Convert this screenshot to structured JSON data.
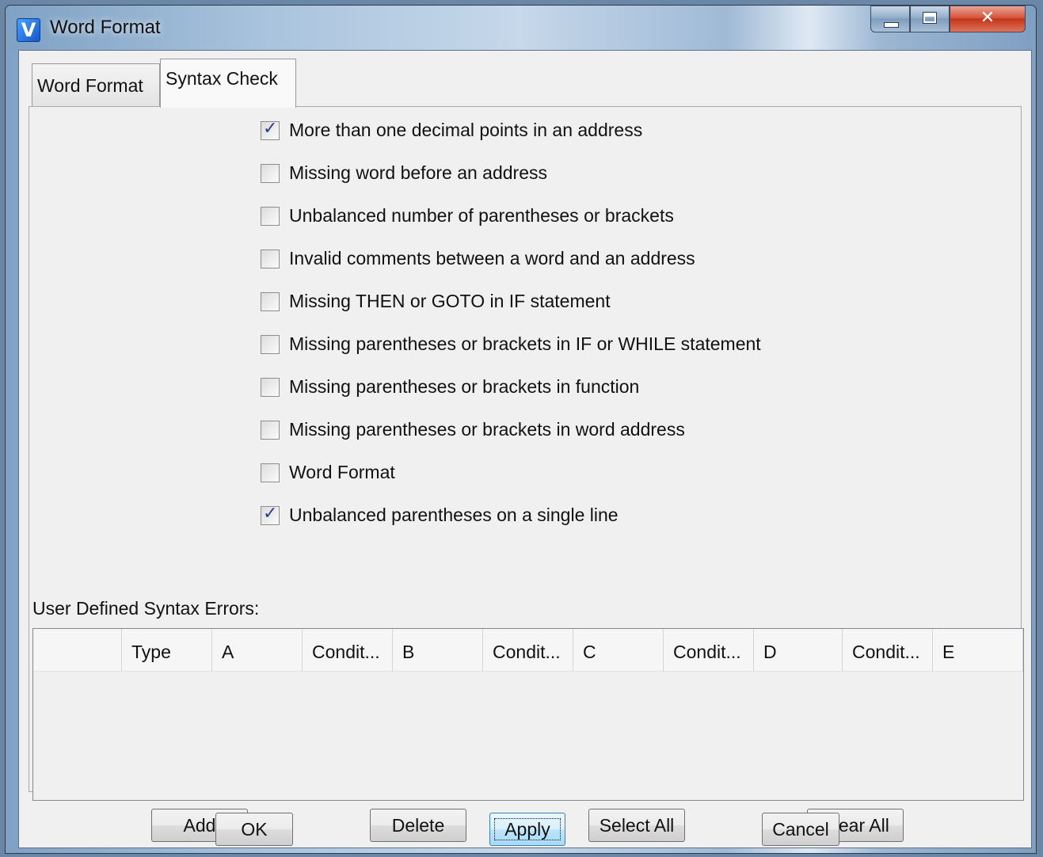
{
  "window": {
    "title": "Word Format",
    "icon_glyph": "V"
  },
  "tabs": [
    {
      "label": "Word Format",
      "active": false
    },
    {
      "label": "Syntax Check",
      "active": true
    }
  ],
  "checks": [
    {
      "label": "More than one decimal points in an address",
      "checked": true
    },
    {
      "label": "Missing word before an address",
      "checked": false
    },
    {
      "label": "Unbalanced number of parentheses or brackets",
      "checked": false
    },
    {
      "label": "Invalid comments between a word and an address",
      "checked": false
    },
    {
      "label": "Missing THEN or GOTO in IF statement",
      "checked": false
    },
    {
      "label": "Missing parentheses or brackets in IF or WHILE statement",
      "checked": false
    },
    {
      "label": "Missing parentheses or brackets in function",
      "checked": false
    },
    {
      "label": "Missing parentheses or brackets in word address",
      "checked": false
    },
    {
      "label": "Word Format",
      "checked": false
    },
    {
      "label": "Unbalanced parentheses on a single line",
      "checked": true
    }
  ],
  "user_defined": {
    "label": "User Defined Syntax Errors:",
    "columns": [
      "",
      "Type",
      "A",
      "Condit...",
      "B",
      "Condit...",
      "C",
      "Condit...",
      "D",
      "Condit...",
      "E"
    ],
    "rows": []
  },
  "grid_buttons": {
    "add": "Add",
    "delete": "Delete",
    "select_all": "Select All",
    "clear_all": "Clear All"
  },
  "dialog_buttons": {
    "ok": "OK",
    "apply": "Apply",
    "cancel": "Cancel"
  },
  "icons": {
    "app": "app-v-icon",
    "minimize": "minimize-icon",
    "maximize": "maximize-icon",
    "close": "close-icon",
    "check": "checkmark-icon"
  }
}
